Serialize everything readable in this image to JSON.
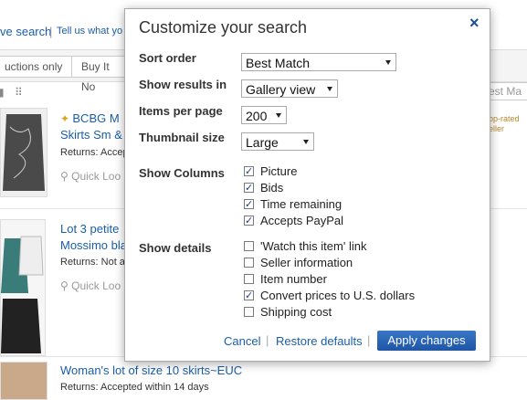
{
  "background": {
    "search_link": "ve search",
    "separator": "|",
    "tell_link": "Tell us what yo",
    "tabs": [
      "uctions only",
      "Buy It No"
    ],
    "best_match": "est Ma",
    "view_icons": [
      "▮",
      "⠿"
    ],
    "items": [
      {
        "title_line1": "BCBG M",
        "title_line2": "Skirts Sm &",
        "returns": "Returns: Accept",
        "quick": "Quick Loo",
        "top_rated": "op-rated\neller"
      },
      {
        "title_line1": "Lot 3 petite",
        "title_line2": "Mossimo bla",
        "returns": "Returns: Not a",
        "quick": "Quick Loo"
      },
      {
        "title_line1": "Woman's lot of size 10 skirts~EUC",
        "returns": "Returns: Accepted within 14 days"
      }
    ]
  },
  "modal": {
    "title": "Customize your search",
    "close": "×",
    "sort_order": {
      "label": "Sort order",
      "value": "Best Match"
    },
    "show_results": {
      "label": "Show results in",
      "value": "Gallery view"
    },
    "items_per_page": {
      "label": "Items per page",
      "value": "200"
    },
    "thumbnail_size": {
      "label": "Thumbnail size",
      "value": "Large"
    },
    "show_columns": {
      "label": "Show Columns",
      "options": [
        {
          "label": "Picture",
          "checked": true
        },
        {
          "label": "Bids",
          "checked": true
        },
        {
          "label": "Time remaining",
          "checked": true
        },
        {
          "label": "Accepts PayPal",
          "checked": true
        }
      ]
    },
    "show_details": {
      "label": "Show details",
      "options": [
        {
          "label": "'Watch this item' link",
          "checked": false
        },
        {
          "label": "Seller information",
          "checked": false
        },
        {
          "label": "Item number",
          "checked": false
        },
        {
          "label": "Convert prices to U.S. dollars",
          "checked": true
        },
        {
          "label": "Shipping cost",
          "checked": false
        }
      ]
    },
    "cancel": "Cancel",
    "restore": "Restore defaults",
    "apply": "Apply changes",
    "footer_sep": "|"
  }
}
